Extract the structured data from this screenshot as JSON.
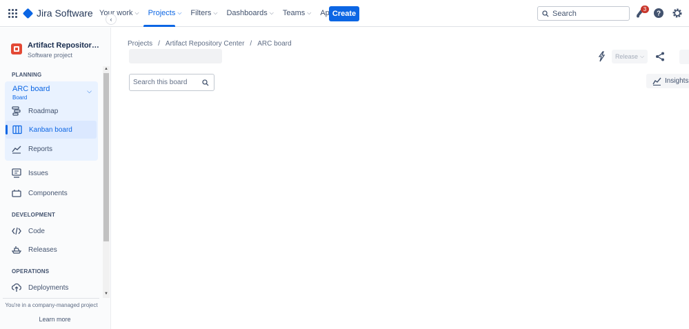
{
  "app": {
    "product_name": "Jira Software"
  },
  "topnav": {
    "links": [
      {
        "label": "Your work"
      },
      {
        "label": "Projects"
      },
      {
        "label": "Filters"
      },
      {
        "label": "Dashboards"
      },
      {
        "label": "Teams"
      },
      {
        "label": "Apps"
      }
    ],
    "active_link": "Projects",
    "create_label": "Create",
    "search_placeholder": "Search",
    "notifications_count": "3",
    "accent_color": "#0c66e4"
  },
  "sidebar": {
    "project_name": "Artifact Repository Center",
    "project_name_display": "Artifact Repository Cen...",
    "project_type": "Software project",
    "sections": {
      "planning": "PLANNING",
      "development": "DEVELOPMENT",
      "operations": "OPERATIONS"
    },
    "board": {
      "name": "ARC board",
      "type": "Board"
    },
    "planning_items": [
      {
        "label": "Roadmap",
        "icon": "roadmap-icon"
      },
      {
        "label": "Kanban board",
        "icon": "kanban-board-icon",
        "selected": true
      },
      {
        "label": "Reports",
        "icon": "reports-icon"
      }
    ],
    "other_items": [
      {
        "label": "Issues",
        "icon": "issues-icon"
      },
      {
        "label": "Components",
        "icon": "components-icon"
      }
    ],
    "development_items": [
      {
        "label": "Code",
        "icon": "code-icon"
      },
      {
        "label": "Releases",
        "icon": "releases-icon"
      }
    ],
    "operations_items": [
      {
        "label": "Deployments",
        "icon": "deployments-icon"
      }
    ],
    "footer_text": "You're in a company-managed project",
    "learn_more": "Learn more"
  },
  "main": {
    "breadcrumb": [
      "Projects",
      "Artifact Repository Center",
      "ARC board"
    ],
    "board_search_placeholder": "Search this board",
    "release_label": "Release",
    "insights_label": "Insights"
  }
}
